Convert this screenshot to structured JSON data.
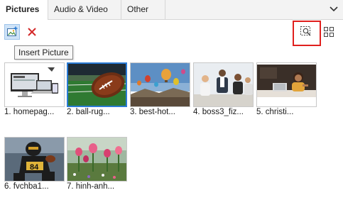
{
  "tabs": [
    {
      "label": "Pictures",
      "active": true
    },
    {
      "label": "Audio & Video",
      "active": false
    },
    {
      "label": "Other",
      "active": false
    }
  ],
  "toolbar": {
    "insert_icon": "insert-picture-icon",
    "delete_icon": "delete-x-icon",
    "select_region_icon": "select-region-icon",
    "grid_icon": "grid-view-icon"
  },
  "tooltip": "Insert Picture",
  "accent_colors": {
    "selection": "#2a7bd5",
    "highlight": "#e0201e",
    "delete": "#d42a2a"
  },
  "thumbnails": [
    {
      "caption": "1. homepag...",
      "selected": false
    },
    {
      "caption": "2. ball-rug...",
      "selected": true
    },
    {
      "caption": "3. best-hot...",
      "selected": false
    },
    {
      "caption": "4. boss3_fiz...",
      "selected": false
    },
    {
      "caption": "5. christi...",
      "selected": false
    },
    {
      "caption": "6. fvchba1...",
      "selected": false
    },
    {
      "caption": "7. hinh-anh...",
      "selected": false
    }
  ]
}
